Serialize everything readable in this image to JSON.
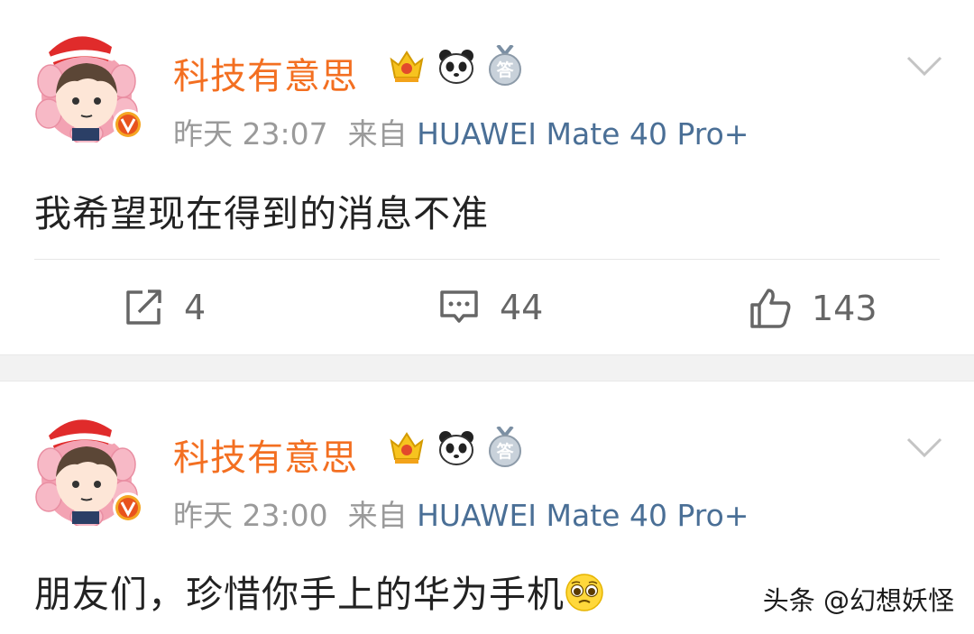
{
  "posts": [
    {
      "author": "科技有意思",
      "time": "昨天 23:07",
      "from_label": "来自",
      "source": "HUAWEI Mate 40 Pro+",
      "text": "我希望现在得到的消息不准",
      "repost_count": "4",
      "comment_count": "44",
      "like_count": "143"
    },
    {
      "author": "科技有意思",
      "time": "昨天 23:00",
      "from_label": "来自",
      "source": "HUAWEI Mate 40 Pro+",
      "text": "朋友们，珍惜你手上的华为手机"
    }
  ],
  "badges": {
    "member_badge": "crown-badge-icon",
    "panda_badge": "panda-badge-icon",
    "answer_badge_text": "答"
  },
  "watermark": "头条 @幻想妖怪",
  "colors": {
    "author": "#f36f21",
    "source_link": "#4a6f96",
    "meta": "#9a9a9a",
    "text": "#222222",
    "action": "#666666",
    "separator": "#f2f2f2"
  }
}
